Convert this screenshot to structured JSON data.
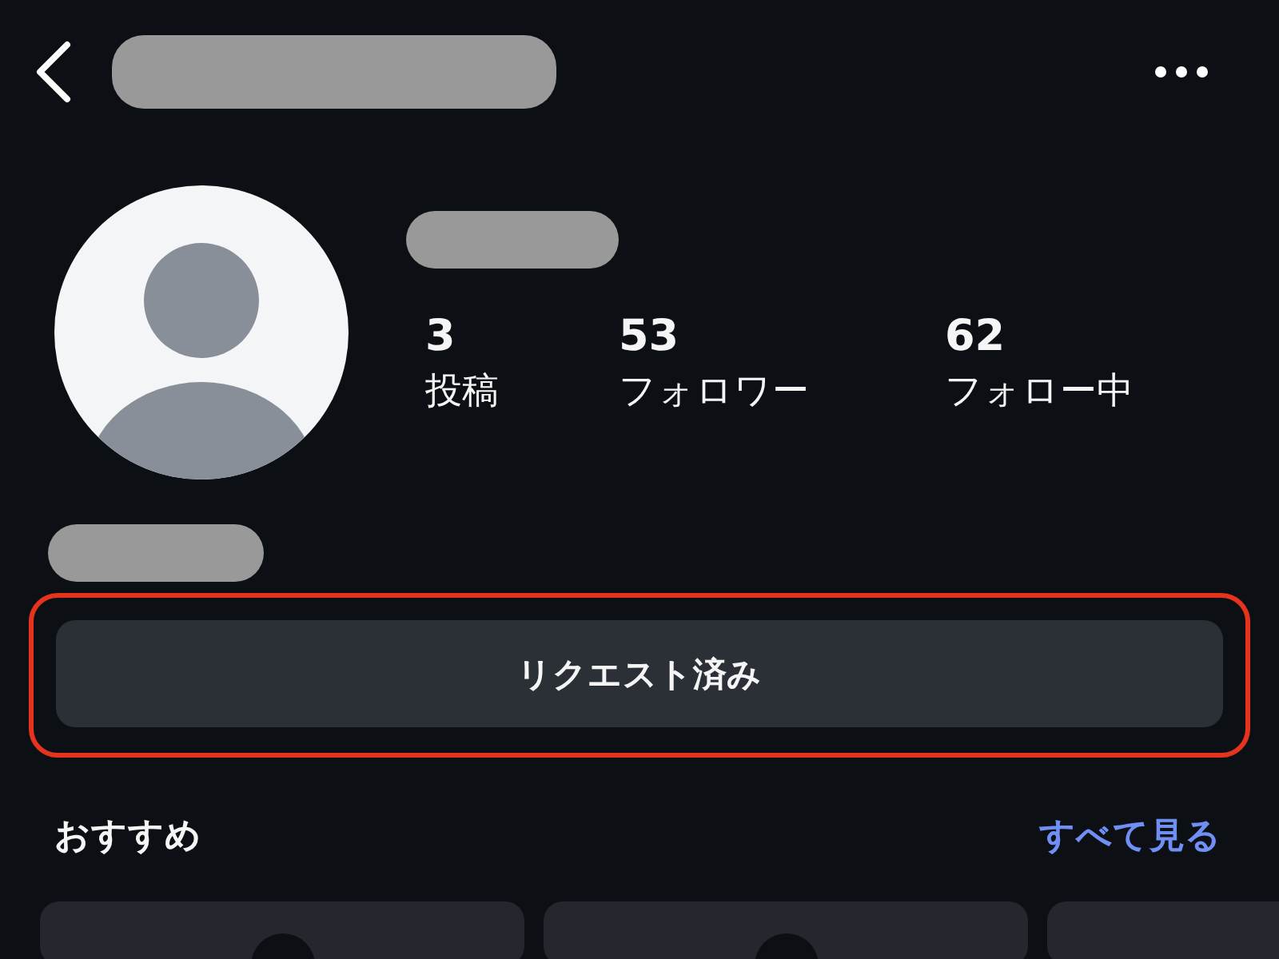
{
  "stats": [
    {
      "value": "3",
      "label": "投稿"
    },
    {
      "value": "53",
      "label": "フォロワー"
    },
    {
      "value": "62",
      "label": "フォロー中"
    }
  ],
  "request_button": {
    "label": "リクエスト済み",
    "highlighted": true
  },
  "suggestions": {
    "title": "おすすめ",
    "see_all": "すべて見る"
  }
}
